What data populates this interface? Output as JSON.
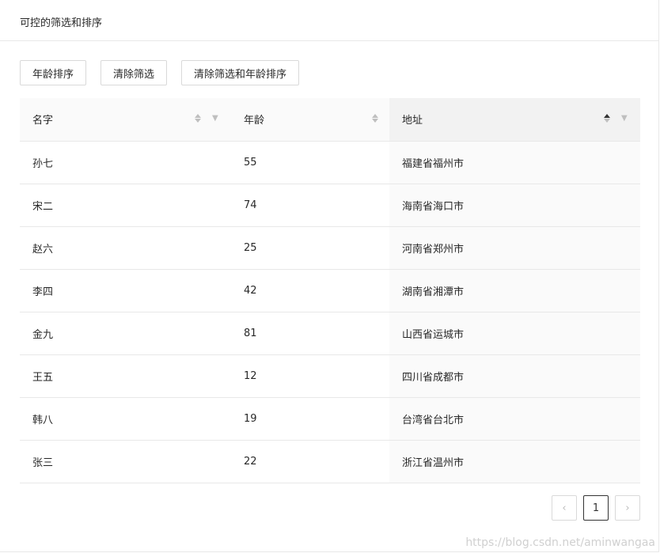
{
  "title": "可控的筛选和排序",
  "buttons": [
    "年龄排序",
    "清除筛选",
    "清除筛选和年龄排序"
  ],
  "columns": [
    "名字",
    "年龄",
    "地址"
  ],
  "rows": [
    [
      "孙七",
      "55",
      "福建省福州市"
    ],
    [
      "宋二",
      "74",
      "海南省海口市"
    ],
    [
      "赵六",
      "25",
      "河南省郑州市"
    ],
    [
      "李四",
      "42",
      "湖南省湘潭市"
    ],
    [
      "金九",
      "81",
      "山西省运城市"
    ],
    [
      "王五",
      "12",
      "四川省成都市"
    ],
    [
      "韩八",
      "19",
      "台湾省台北市"
    ],
    [
      "张三",
      "22",
      "浙江省温州市"
    ]
  ],
  "pagination": {
    "prev": "‹",
    "current": "1",
    "next": "›"
  },
  "watermark": "https://blog.csdn.net/aminwangaa"
}
